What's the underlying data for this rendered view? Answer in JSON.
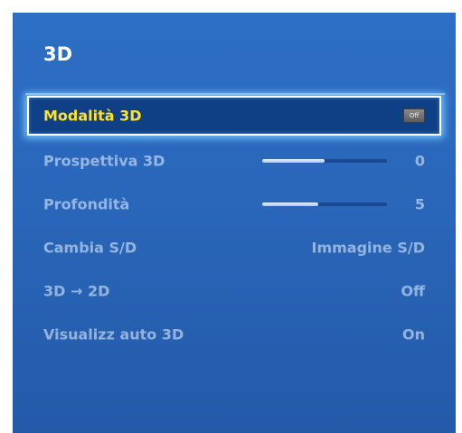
{
  "menu": {
    "title": "3D",
    "items": [
      {
        "label": "Modalità 3D",
        "value": "Off",
        "type": "badge",
        "selected": true
      },
      {
        "label": "Prospettiva 3D",
        "value": "0",
        "type": "slider",
        "level": 0.5
      },
      {
        "label": "Profondità",
        "value": "5",
        "type": "slider",
        "level": 0.45
      },
      {
        "label": "Cambia S/D",
        "value": "Immagine S/D",
        "type": "text"
      },
      {
        "label": "3D → 2D",
        "value": "Off",
        "type": "text"
      },
      {
        "label": "Visualizz auto 3D",
        "value": "On",
        "type": "text"
      }
    ]
  },
  "colors": {
    "panel_background": "#2a67bb",
    "selected_background": "#0f3f85",
    "selected_text": "#ffe22a",
    "title_text": "#ffffff"
  }
}
